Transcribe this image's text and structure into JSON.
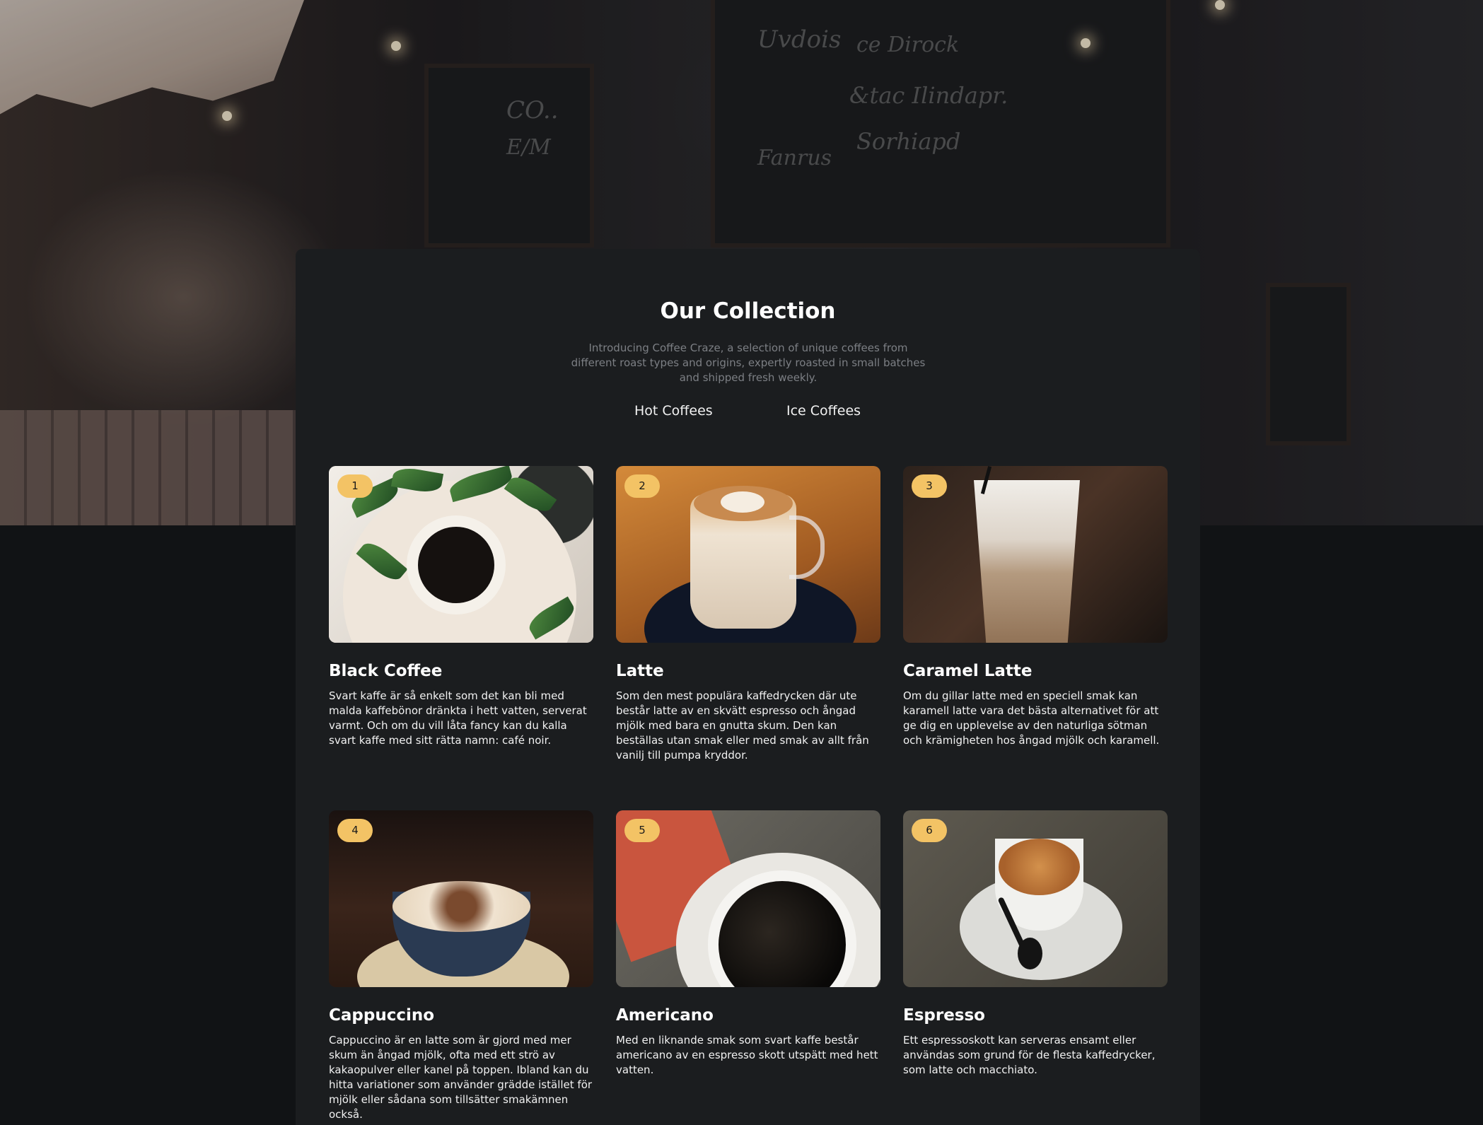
{
  "section": {
    "title": "Our Collection",
    "subtitle": "Introducing Coffee Craze, a selection of unique coffees from different roast types and origins, expertly roasted in small batches and shipped fresh weekly."
  },
  "tabs": [
    {
      "label": "Hot Coffees"
    },
    {
      "label": "Ice Coffees"
    }
  ],
  "products": [
    {
      "badge": "1",
      "name": "Black Coffee",
      "image_icon": "black-coffee-photo",
      "description": "Svart kaffe är så enkelt som det kan bli med malda kaffebönor dränkta i hett vatten, serverat varmt. Och om du vill låta fancy kan du kalla svart kaffe med sitt rätta namn: café noir."
    },
    {
      "badge": "2",
      "name": "Latte",
      "image_icon": "latte-photo",
      "description": "Som den mest populära kaffedrycken där ute består latte av en skvätt espresso och ångad mjölk med bara en gnutta skum. Den kan beställas utan smak eller med smak av allt från vanilj till pumpa kryddor."
    },
    {
      "badge": "3",
      "name": "Caramel Latte",
      "image_icon": "caramel-latte-photo",
      "description": "Om du gillar latte med en speciell smak kan karamell latte vara det bästa alternativet för att ge dig en upplevelse av den naturliga sötman och krämigheten hos ångad mjölk och karamell."
    },
    {
      "badge": "4",
      "name": "Cappuccino",
      "image_icon": "cappuccino-photo",
      "description": "Cappuccino är en latte som är gjord med mer skum än ångad mjölk, ofta med ett strö av kakaopulver eller kanel på toppen. Ibland kan du hitta variationer som använder grädde istället för mjölk eller sådana som tillsätter smakämnen också."
    },
    {
      "badge": "5",
      "name": "Americano",
      "image_icon": "americano-photo",
      "description": "Med en liknande smak som svart kaffe består americano av en espresso skott utspätt med hett vatten."
    },
    {
      "badge": "6",
      "name": "Espresso",
      "image_icon": "espresso-photo",
      "description": "Ett espressoskott kan serveras ensamt eller användas som grund för de flesta kaffedrycker, som latte och macchiato."
    }
  ],
  "colors": {
    "page_bg": "#111315",
    "panel_bg": "#1b1d1f",
    "badge": "#f3c365",
    "subtitle": "#7c7f84"
  }
}
